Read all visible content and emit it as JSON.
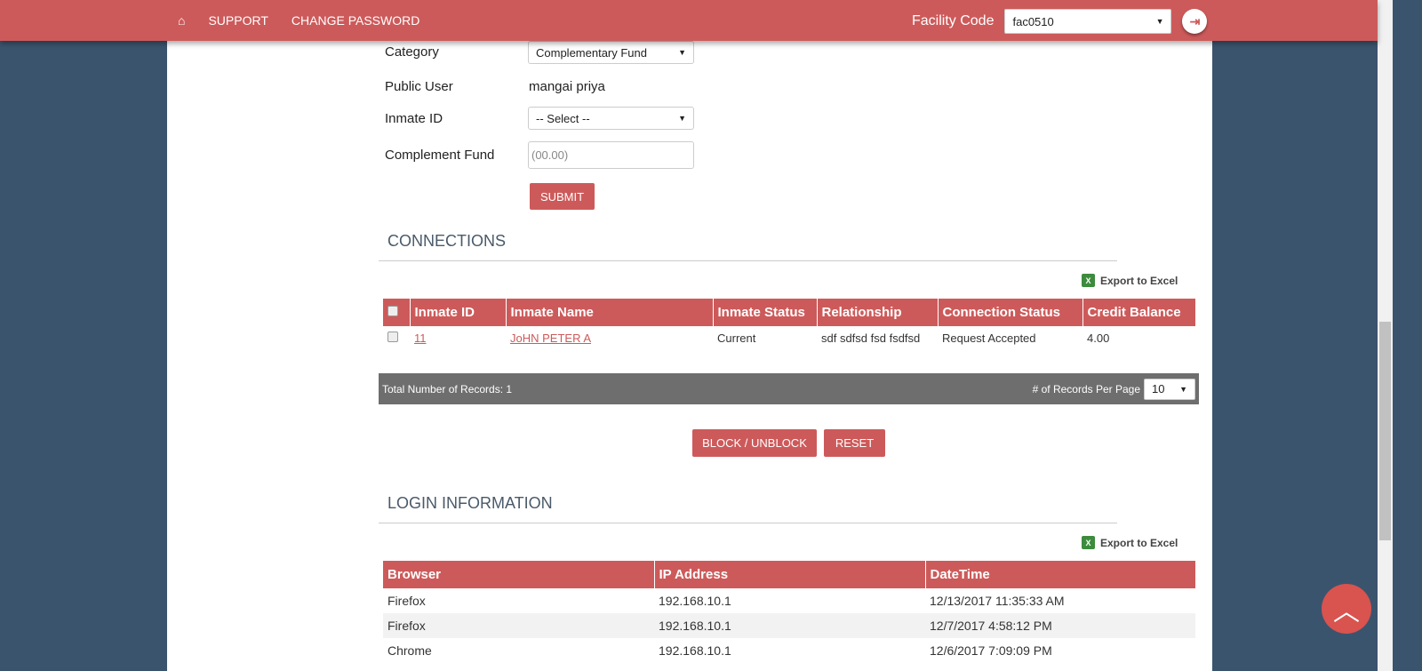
{
  "nav": {
    "home_icon": "home-icon",
    "support": "SUPPORT",
    "change_password": "CHANGE PASSWORD",
    "facility_label": "Facility Code",
    "facility_value": "fac0510",
    "logout_icon": "logout-icon"
  },
  "form": {
    "category_label": "Category",
    "category_value": "Complementary Fund",
    "public_user_label": "Public User",
    "public_user_value": "mangai priya",
    "inmate_id_label": "Inmate ID",
    "inmate_id_value": "-- Select --",
    "fund_label": "Complement Fund",
    "fund_placeholder": "(00.00)",
    "submit": "SUBMIT"
  },
  "connections": {
    "title": "CONNECTIONS",
    "export": "Export to Excel",
    "headers": [
      "Inmate ID",
      "Inmate Name",
      "Inmate Status",
      "Relationship",
      "Connection Status",
      "Credit Balance"
    ],
    "rows": [
      {
        "id": "11",
        "name": "JoHN PETER A",
        "status": "Current",
        "relationship": "sdf sdfsd fsd fsdfsd",
        "connection": "Request Accepted",
        "balance": "4.00"
      }
    ],
    "total": "Total Number of Records: 1",
    "per_page_label": "# of Records Per Page",
    "per_page": "10",
    "block": "BLOCK / UNBLOCK",
    "reset": "RESET"
  },
  "login": {
    "title": "LOGIN INFORMATION",
    "export": "Export to Excel",
    "headers": [
      "Browser",
      "IP Address",
      "DateTime"
    ],
    "rows": [
      [
        "Firefox",
        "192.168.10.1",
        "12/13/2017 11:35:33 AM"
      ],
      [
        "Firefox",
        "192.168.10.1",
        "12/7/2017 4:58:12 PM"
      ],
      [
        "Chrome",
        "192.168.10.1",
        "12/6/2017 7:09:09 PM"
      ]
    ]
  },
  "colors": {
    "accent": "#cd5a5a",
    "background": "#3b546e"
  }
}
